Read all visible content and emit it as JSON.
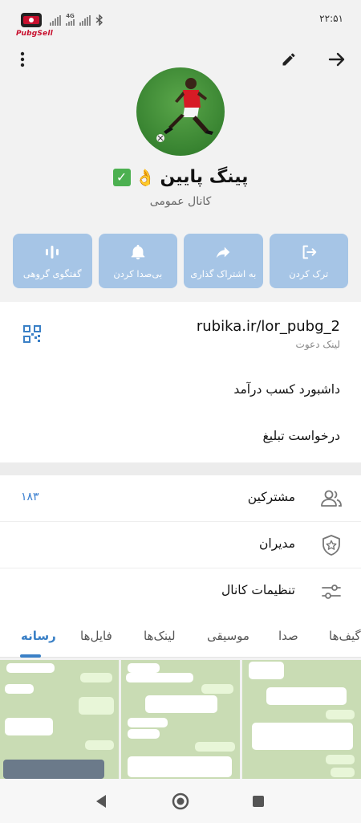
{
  "status_bar": {
    "time": "۲۲:۵۱",
    "brand": "PubgSell",
    "network": "4G"
  },
  "channel": {
    "title": "پینگ پایین",
    "title_emojis": [
      "👌",
      "✅"
    ],
    "subtitle": "کانال عمومی"
  },
  "actions": [
    {
      "icon": "leave-icon",
      "label": "ترک کردن"
    },
    {
      "icon": "share-icon",
      "label": "به اشتراک گذاری"
    },
    {
      "icon": "bell-icon",
      "label": "بی‌صدا کردن"
    },
    {
      "icon": "voice-chat-icon",
      "label": "گفتگوی گروهی"
    }
  ],
  "info": {
    "link": "rubika.ir/lor_pubg_2",
    "link_label": "لینک دعوت",
    "income_dashboard": "داشبورد کسب درآمد",
    "ad_request": "درخواست تبلیغ"
  },
  "management": [
    {
      "icon": "members-icon",
      "label": "مشترکین",
      "value": "۱۸۳"
    },
    {
      "icon": "admin-shield-icon",
      "label": "مدیران",
      "value": ""
    },
    {
      "icon": "settings-sliders-icon",
      "label": "تنظیمات کانال",
      "value": ""
    }
  ],
  "tabs": [
    "رسانه",
    "فایل‌ها",
    "لینک‌ها",
    "موسیقی",
    "صدا",
    "گیف‌ها"
  ],
  "active_tab": "رسانه",
  "colors": {
    "accent": "#3a80c6",
    "action_button": "#a6c5e6",
    "check_green": "#4cb050"
  }
}
